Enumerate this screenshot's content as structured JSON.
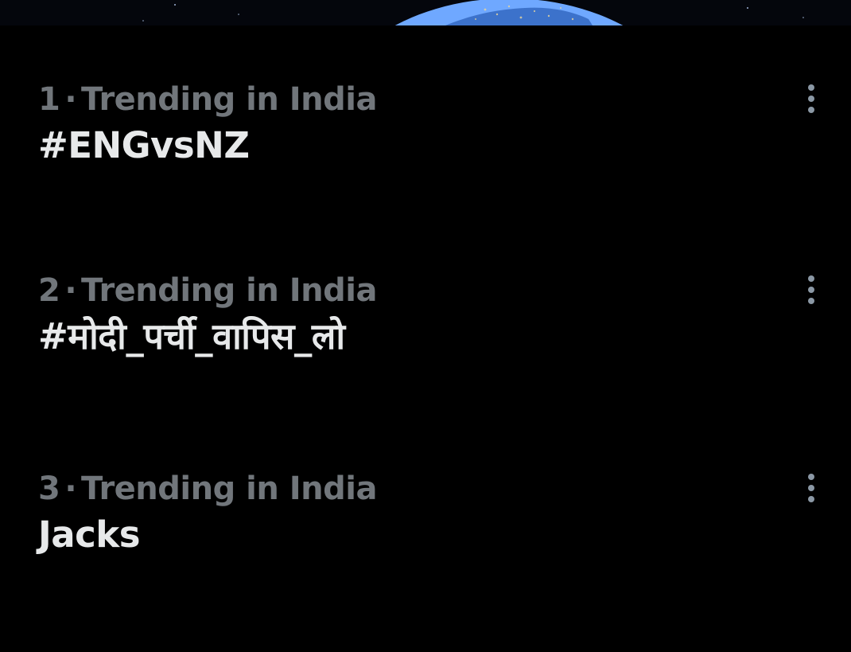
{
  "trends": [
    {
      "rank": "1",
      "separator": "·",
      "context": "Trending in India",
      "topic": "#ENGvsNZ",
      "menu_icon": "more-vertical-icon"
    },
    {
      "rank": "2",
      "separator": "·",
      "context": "Trending in India",
      "topic": "#मोदी_पर्ची_वापिस_लो",
      "menu_icon": "more-vertical-icon"
    },
    {
      "rank": "3",
      "separator": "·",
      "context": "Trending in India",
      "topic": "Jacks",
      "menu_icon": "more-vertical-icon"
    }
  ],
  "colors": {
    "background": "#000000",
    "meta_text": "#71767b",
    "topic_text": "#e7e9ea",
    "icon": "#8b98a5"
  }
}
